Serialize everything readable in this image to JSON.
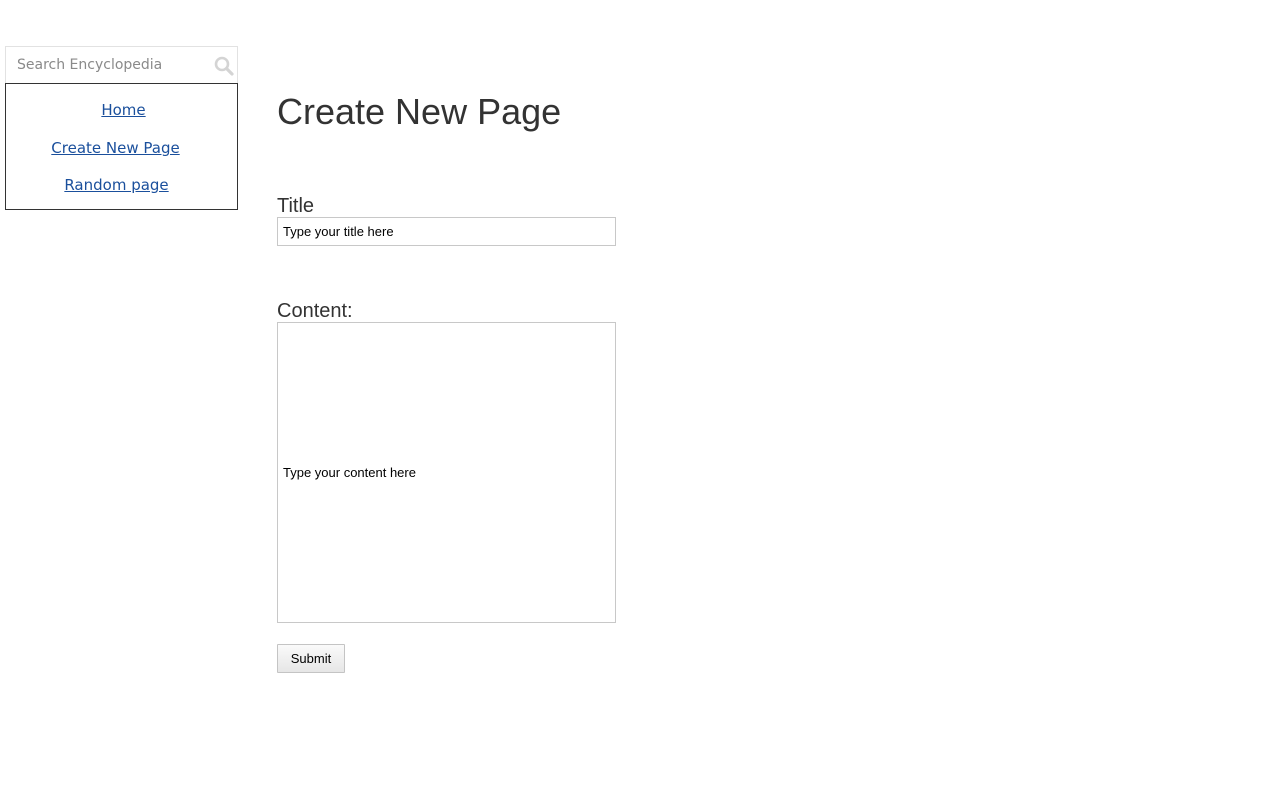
{
  "search": {
    "placeholder": "Search Encyclopedia",
    "icon": "search-icon"
  },
  "nav": {
    "items": [
      {
        "label": "Home"
      },
      {
        "label": "Create New Page"
      },
      {
        "label": "Random page"
      }
    ],
    "link_color": "#1a4f9c"
  },
  "main": {
    "heading": "Create New Page",
    "title_label": "Title",
    "title_value": "Type your title here",
    "content_label": "Content:",
    "content_value": "Type your content here",
    "submit_label": "Submit"
  }
}
